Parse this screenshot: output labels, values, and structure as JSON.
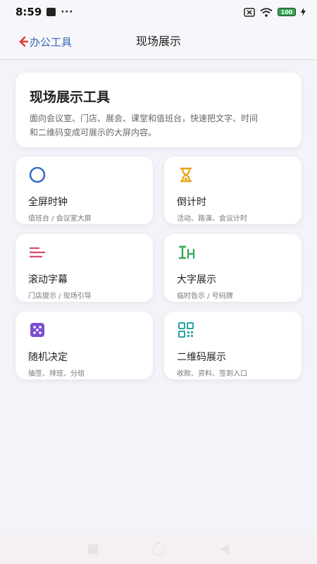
{
  "status": {
    "time": "8:59",
    "dots": "···",
    "battery": "100"
  },
  "header": {
    "back_label": "办公工具",
    "title": "现场展示"
  },
  "hero": {
    "title": "现场展示工具",
    "desc_line1": "面向会议室、门店、展会、课堂和值班台，快速把文字、时间",
    "desc_line2": "和二维码变成可展示的大屏内容。"
  },
  "cards": [
    {
      "label": "全屏时钟",
      "sub": "值班台 / 会议室大屏",
      "icon": "clock-circle-icon"
    },
    {
      "label": "倒计时",
      "sub": "活动、路演、会议计时",
      "icon": "hourglass-icon"
    },
    {
      "label": "滚动字幕",
      "sub": "门店提示 / 现场引导",
      "icon": "marquee-lines-icon"
    },
    {
      "label": "大字展示",
      "sub": "临时告示 / 号码牌",
      "icon": "big-text-icon"
    },
    {
      "label": "随机决定",
      "sub": "抽签、排班、分组",
      "icon": "dice-icon"
    },
    {
      "label": "二维码展示",
      "sub": "收款、资料、签到入口",
      "icon": "qr-code-icon"
    }
  ],
  "colors": {
    "accent_blue": "#3a67b8",
    "back_arrow": "#e53935",
    "clock": "#3b6fc4",
    "hourglass": "#e3a21a",
    "marquee": "#d64a6e",
    "big_text": "#2fa84f",
    "dice": "#7b4fd0",
    "qr": "#2aa3a6"
  }
}
